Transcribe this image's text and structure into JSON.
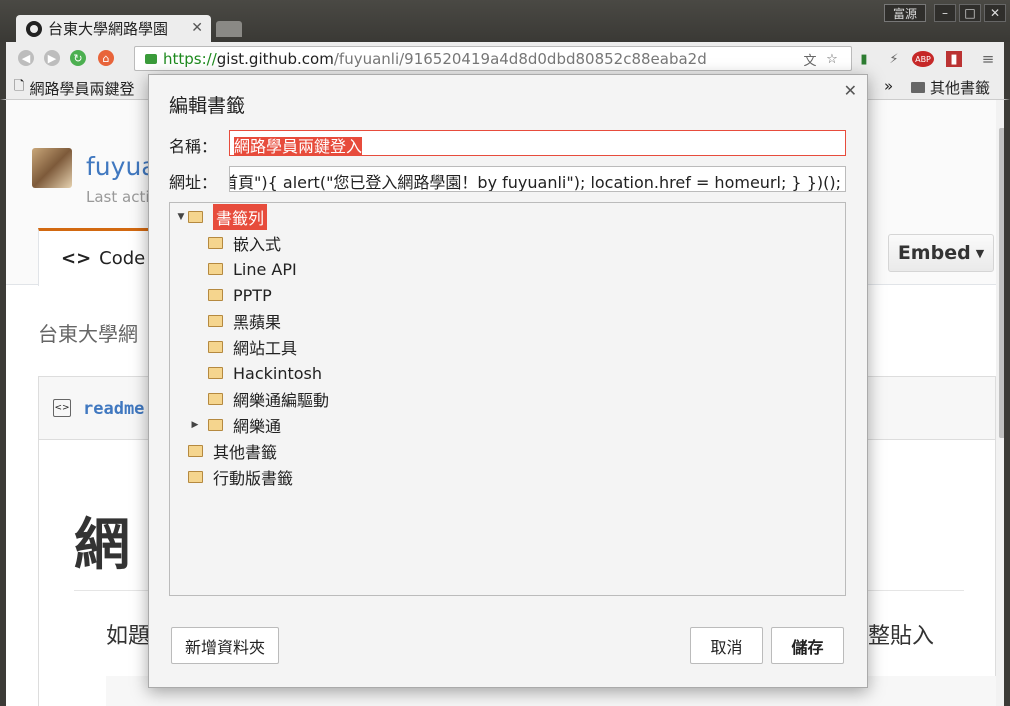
{
  "browser": {
    "tab_title": "台東大學網路學園",
    "user_badge": "富源",
    "url_scheme": "https://",
    "url_host": "gist.github.com",
    "url_path": "/fuyuanli/916520419a4d8d0dbd80852c88eaba2d"
  },
  "bookmarks_bar": {
    "first_item": "網路學員兩鍵登",
    "overflow": "»",
    "other_bookmarks": "其他書籤"
  },
  "page": {
    "owner": "fuyua",
    "last_active": "Last acti",
    "code_tab": "Code",
    "embed_button": "Embed",
    "description": "台東大學網",
    "file_name": "readme",
    "heading": "網",
    "paragraph_left": "如題",
    "paragraph_right": "完整貼入"
  },
  "dialog": {
    "title": "編輯書籤",
    "name_label": "名稱：",
    "name_value": "網路學員兩鍵登入",
    "url_label": "網址：",
    "url_value": "/首頁\"){ alert(\"您已登入網路學園！by fuyuanli\"); location.href = homeurl; } })();",
    "tree": [
      {
        "label": "書籤列",
        "selected": true,
        "expanded": true
      },
      {
        "label": "嵌入式"
      },
      {
        "label": "Line API"
      },
      {
        "label": "PPTP"
      },
      {
        "label": "黑蘋果"
      },
      {
        "label": "網站工具"
      },
      {
        "label": "Hackintosh"
      },
      {
        "label": "網樂通編驅動"
      },
      {
        "label": "網樂通",
        "collapsed": true
      },
      {
        "label": "其他書籤"
      },
      {
        "label": "行動版書籤"
      }
    ],
    "new_folder_button": "新增資料夾",
    "cancel_button": "取消",
    "save_button": "儲存"
  },
  "colors": {
    "accent_red": "#e74c3c",
    "link_blue": "#4078c0",
    "code_tab_orange": "#d26911"
  }
}
